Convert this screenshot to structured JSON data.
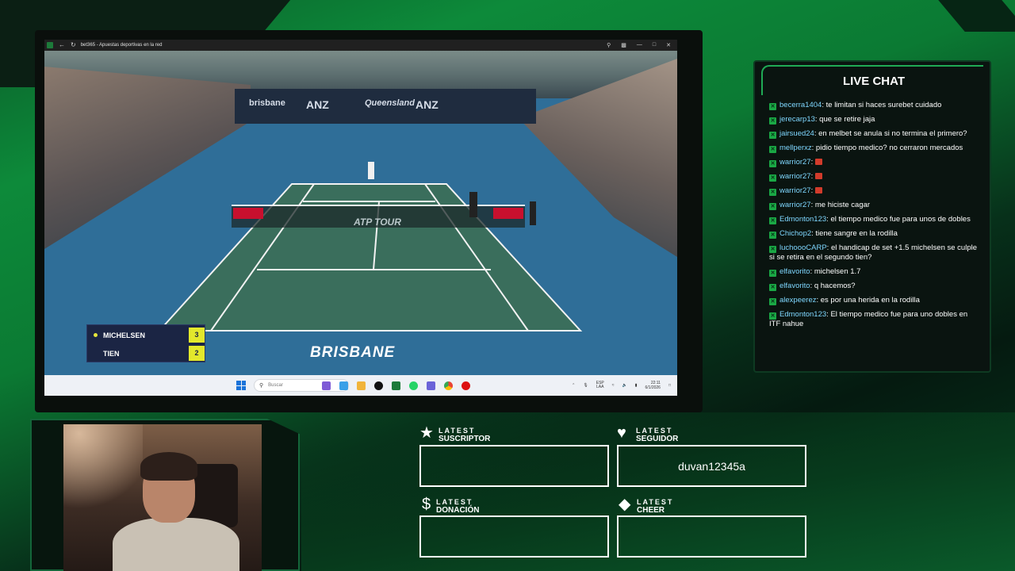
{
  "browser": {
    "title": "bet365 - Apuestas deportivas en la red",
    "icons": [
      "back-icon",
      "refresh-icon",
      "zoom-icon",
      "extensions-icon",
      "minimize-icon",
      "restore-icon",
      "close-icon"
    ]
  },
  "stream": {
    "ad_banners": [
      "brisbane",
      "ANZ",
      "Queensland",
      "ANZ"
    ],
    "net_branding": "ATP TOUR",
    "location_text": "BRISBANE",
    "scoreboard": {
      "players": [
        {
          "name": "MICHELSEN",
          "score": "3",
          "serving": true
        },
        {
          "name": "TIEN",
          "score": "2",
          "serving": false
        }
      ],
      "accent": "#e3e82c"
    }
  },
  "taskbar": {
    "search_placeholder": "Buscar",
    "lang_top": "ESP",
    "lang_bottom": "LAA",
    "time": "22:11",
    "date": "6/1/2026"
  },
  "chat": {
    "title": "LIVE CHAT",
    "messages": [
      {
        "user": "becerra1404",
        "text": ": te limitan si haces surebet cuidado"
      },
      {
        "user": "jerecarp13",
        "text": ": que se retire jaja"
      },
      {
        "user": "jairsued24",
        "text": ": en melbet se anula si no termina el primero?"
      },
      {
        "user": "mellperxz",
        "text": ": pidio tiempo medico? no cerraron mercados"
      },
      {
        "user": "warrior27",
        "text": ":",
        "emote": true
      },
      {
        "user": "warrior27",
        "text": ":",
        "emote": true
      },
      {
        "user": "warrior27",
        "text": ":",
        "emote": true
      },
      {
        "user": "warrior27",
        "text": ": me hiciste cagar"
      },
      {
        "user": "Edmonton123",
        "text": ": el tiempo medico fue para unos de dobles"
      },
      {
        "user": "Chichop2",
        "text": ": tiene sangre en la rodilla"
      },
      {
        "user": "luchoooCARP",
        "text": ": el handicap de set +1.5 michelsen se culple si se retira en el segundo tien?"
      },
      {
        "user": "elfavorito",
        "text": ": michelsen 1.7"
      },
      {
        "user": "elfavorito",
        "text": ": q hacemos?"
      },
      {
        "user": "alexpeerez",
        "text": ": es por una herida en la rodilla"
      },
      {
        "user": "Edmonton123",
        "text": ": El tiempo medico fue para uno dobles en ITF nahue"
      }
    ]
  },
  "alerts": {
    "suscriptor": {
      "small": "LATEST",
      "big": "SUSCRIPTOR",
      "value": ""
    },
    "seguidor": {
      "small": "LATEST",
      "big": "SEGUIDOR",
      "value": "duvan12345a"
    },
    "donacion": {
      "small": "LATEST",
      "big": "DONACIÓN",
      "value": ""
    },
    "cheer": {
      "small": "LATEST",
      "big": "CHEER",
      "value": ""
    }
  },
  "colors": {
    "brand_green": "#0d8a3a",
    "chat_username": "#7fd7ff",
    "chat_bg": "#0a1410"
  }
}
